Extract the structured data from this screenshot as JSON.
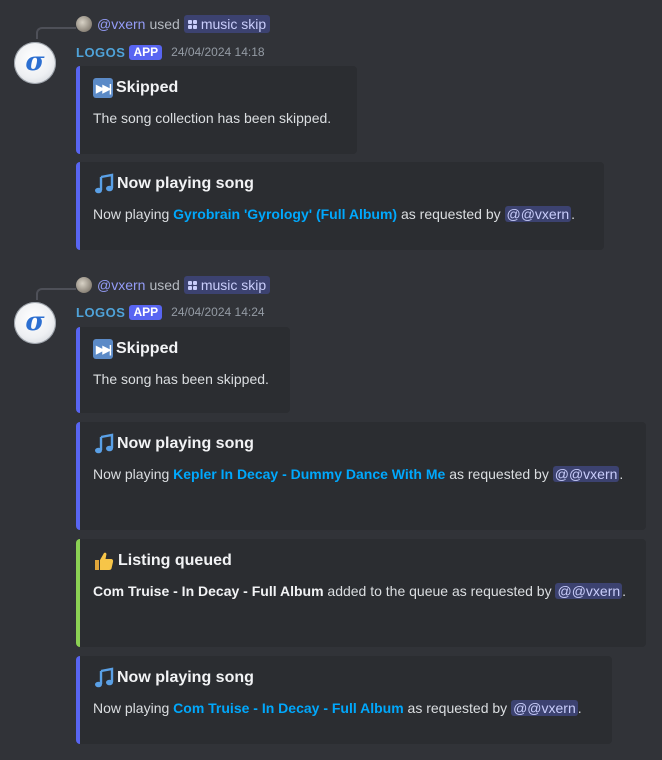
{
  "messages": [
    {
      "reply": {
        "user": "@vxern",
        "used": "used",
        "command": "music skip"
      },
      "author": {
        "name": "LOGOS",
        "badge": "APP",
        "timestamp": "24/04/2024 14:18"
      },
      "embeds": [
        {
          "icon": "skip-icon",
          "title": "Skipped",
          "desc": "The song collection has been skipped.",
          "accent": "#5865f2"
        },
        {
          "icon": "music-note-icon",
          "title": "Now playing song",
          "prefix": "Now playing ",
          "link": "Gyrobrain 'Gyrology' (Full Album)",
          "middle": " as requested by ",
          "mention": "@@vxern",
          "suffix": ".",
          "accent": "#5865f2"
        }
      ]
    },
    {
      "reply": {
        "user": "@vxern",
        "used": "used",
        "command": "music skip"
      },
      "author": {
        "name": "LOGOS",
        "badge": "APP",
        "timestamp": "24/04/2024 14:24"
      },
      "embeds": [
        {
          "icon": "skip-icon",
          "title": "Skipped",
          "desc": "The song has been skipped.",
          "accent": "#5865f2"
        },
        {
          "icon": "music-note-icon",
          "title": "Now playing song",
          "prefix": "Now playing ",
          "link": "Kepler In Decay - Dummy Dance With Me",
          "middle": " as requested by ",
          "mention": "@@vxern",
          "suffix": ".",
          "accent": "#5865f2"
        },
        {
          "icon": "thumbs-up-icon",
          "title": "Listing queued",
          "bold": "Com Truise - In Decay - Full Album",
          "middle": " added to the queue as requested by ",
          "mention": "@@vxern",
          "suffix": ".",
          "accent": "#8bd154"
        },
        {
          "icon": "music-note-icon",
          "title": "Now playing song",
          "prefix": "Now playing ",
          "link": "Com Truise - In Decay - Full Album",
          "middle": " as requested by ",
          "mention": "@@vxern",
          "suffix": ".",
          "accent": "#5865f2"
        }
      ]
    }
  ]
}
